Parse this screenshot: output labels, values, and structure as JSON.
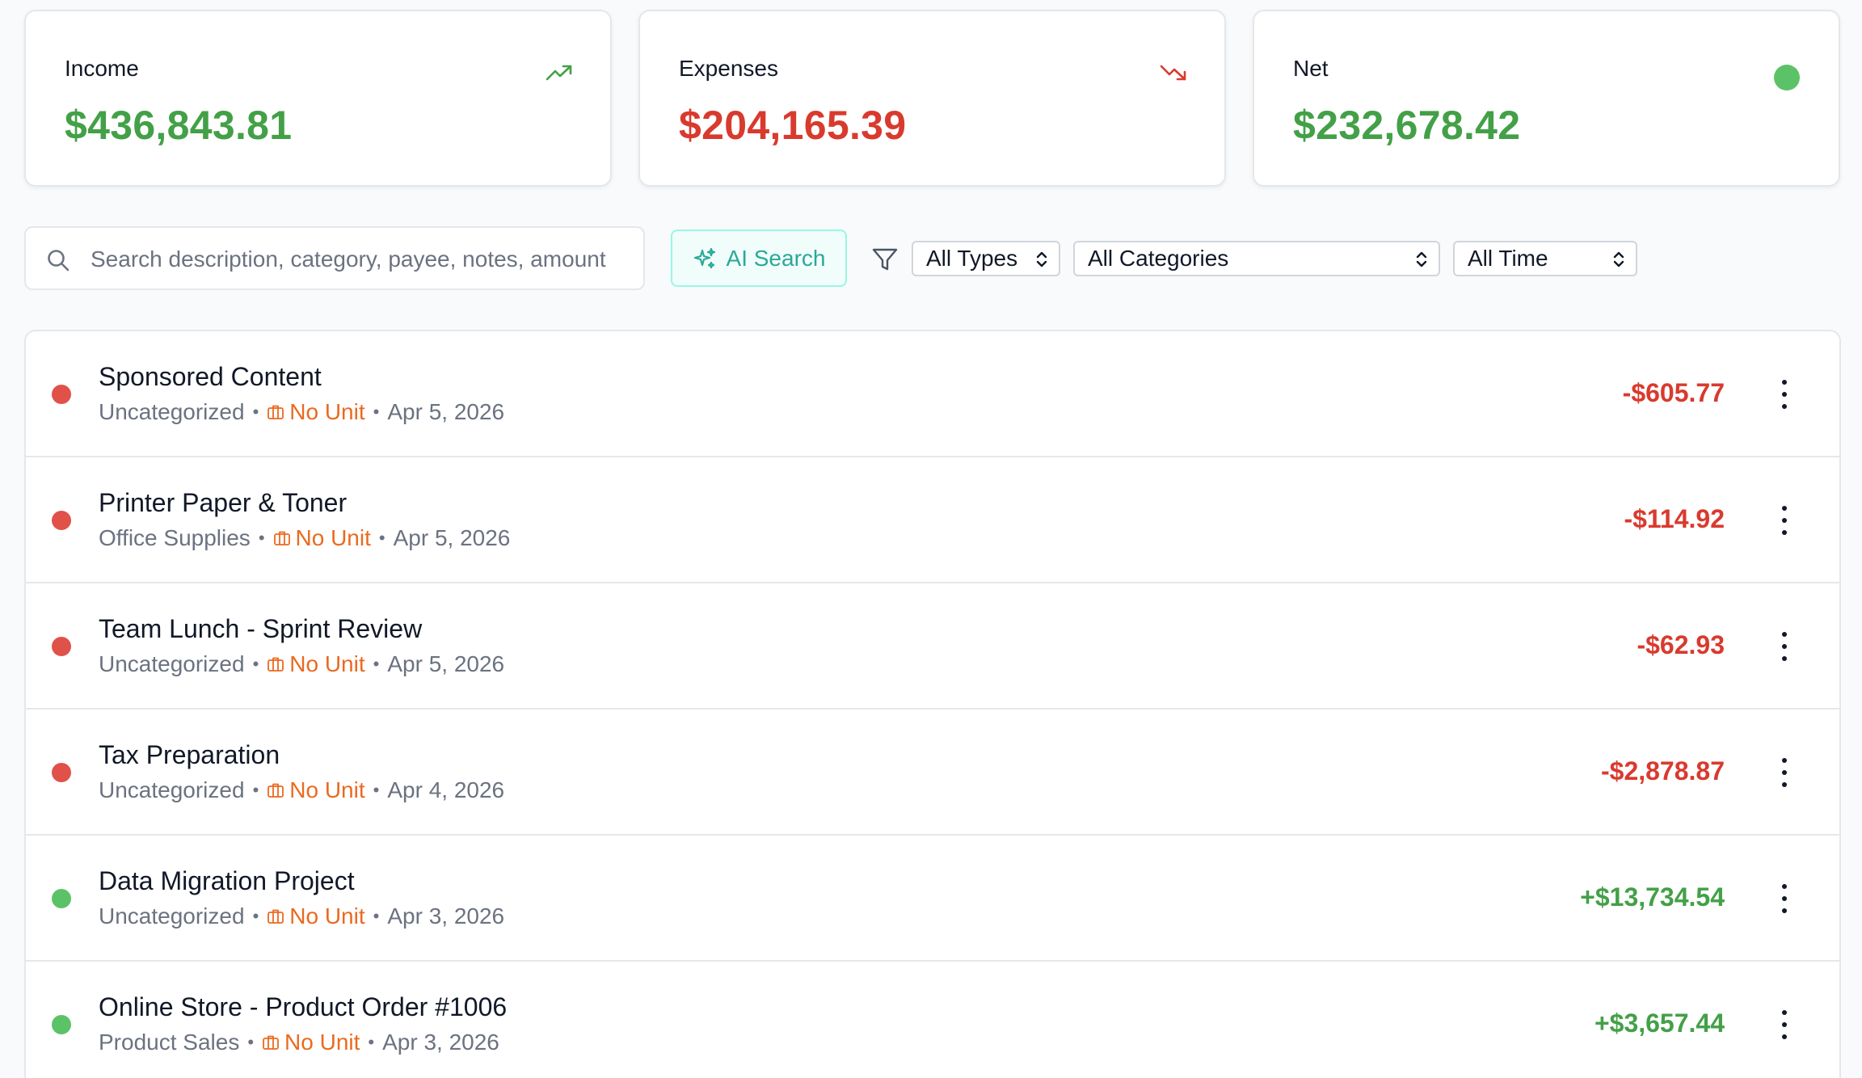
{
  "summary": {
    "income": {
      "label": "Income",
      "value": "$436,843.81",
      "icon": "trending-up-icon"
    },
    "expenses": {
      "label": "Expenses",
      "value": "$204,165.39",
      "icon": "trending-down-icon"
    },
    "net": {
      "label": "Net",
      "value": "$232,678.42",
      "indicator": "status-dot"
    }
  },
  "toolbar": {
    "search_placeholder": "Search description, category, payee, notes, amount",
    "search_value": "",
    "ai_search_label": "AI Search",
    "types_select": "All Types",
    "categories_select": "All Categories",
    "time_select": "All Time"
  },
  "colors": {
    "income_green": "#43a047",
    "expense_red": "#d93a2e",
    "dot_green": "#5cc267",
    "dot_red": "#e0514a",
    "unit_orange": "#ea6a1f",
    "ai_teal": "#2aa899"
  },
  "transactions": [
    {
      "title": "Sponsored Content",
      "category": "Uncategorized",
      "unit": "No Unit",
      "date": "Apr 5, 2026",
      "amount": "-$605.77",
      "type": "expense"
    },
    {
      "title": "Printer Paper & Toner",
      "category": "Office Supplies",
      "unit": "No Unit",
      "date": "Apr 5, 2026",
      "amount": "-$114.92",
      "type": "expense"
    },
    {
      "title": "Team Lunch - Sprint Review",
      "category": "Uncategorized",
      "unit": "No Unit",
      "date": "Apr 5, 2026",
      "amount": "-$62.93",
      "type": "expense"
    },
    {
      "title": "Tax Preparation",
      "category": "Uncategorized",
      "unit": "No Unit",
      "date": "Apr 4, 2026",
      "amount": "-$2,878.87",
      "type": "expense"
    },
    {
      "title": "Data Migration Project",
      "category": "Uncategorized",
      "unit": "No Unit",
      "date": "Apr 3, 2026",
      "amount": "+$13,734.54",
      "type": "income"
    },
    {
      "title": "Online Store - Product Order #1006",
      "category": "Product Sales",
      "unit": "No Unit",
      "date": "Apr 3, 2026",
      "amount": "+$3,657.44",
      "type": "income"
    }
  ]
}
